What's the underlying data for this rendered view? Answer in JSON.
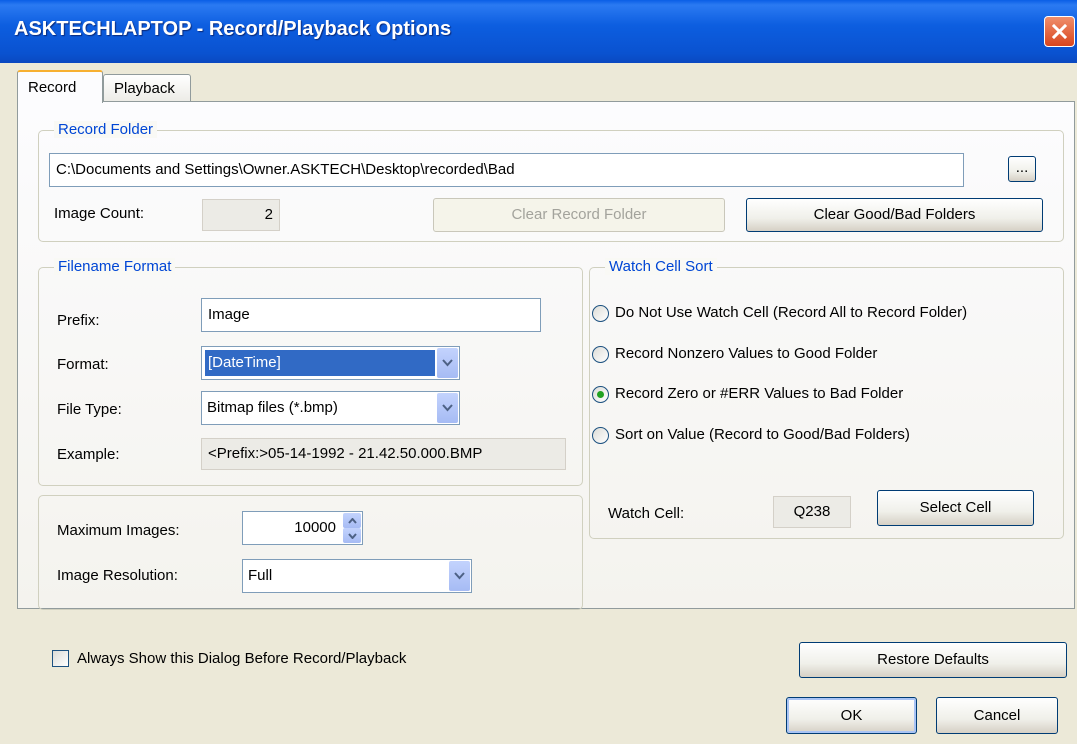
{
  "window": {
    "title": "ASKTECHLAPTOP - Record/Playback Options"
  },
  "tabs": {
    "record": "Record",
    "playback": "Playback"
  },
  "record_folder": {
    "legend": "Record Folder",
    "path": "C:\\Documents and Settings\\Owner.ASKTECH\\Desktop\\recorded\\Bad",
    "browse_label": "...",
    "image_count_label": "Image Count:",
    "image_count": "2",
    "clear_record_label": "Clear Record Folder",
    "clear_good_bad_label": "Clear Good/Bad Folders"
  },
  "filename_format": {
    "legend": "Filename Format",
    "prefix_label": "Prefix:",
    "prefix_value": "Image",
    "format_label": "Format:",
    "format_value": "[DateTime]",
    "file_type_label": "File Type:",
    "file_type_value": "Bitmap files (*.bmp)",
    "example_label": "Example:",
    "example_value": "<Prefix:>05-14-1992 - 21.42.50.000.BMP"
  },
  "images": {
    "max_label": "Maximum Images:",
    "max_value": "10000",
    "resolution_label": "Image Resolution:",
    "resolution_value": "Full"
  },
  "watch_cell_sort": {
    "legend": "Watch Cell Sort",
    "options": [
      {
        "label": "Do Not Use Watch Cell (Record All to Record Folder)",
        "checked": false
      },
      {
        "label": "Record Nonzero Values to Good Folder",
        "checked": false
      },
      {
        "label": "Record Zero or #ERR Values to Bad Folder",
        "checked": true
      },
      {
        "label": "Sort on Value (Record to Good/Bad Folders)",
        "checked": false
      }
    ],
    "watch_cell_label": "Watch Cell:",
    "watch_cell_value": "Q238",
    "select_cell_label": "Select Cell"
  },
  "footer": {
    "always_show_label": "Always Show this Dialog Before Record/Playback",
    "always_show_checked": false,
    "restore_defaults_label": "Restore Defaults",
    "ok_label": "OK",
    "cancel_label": "Cancel"
  }
}
